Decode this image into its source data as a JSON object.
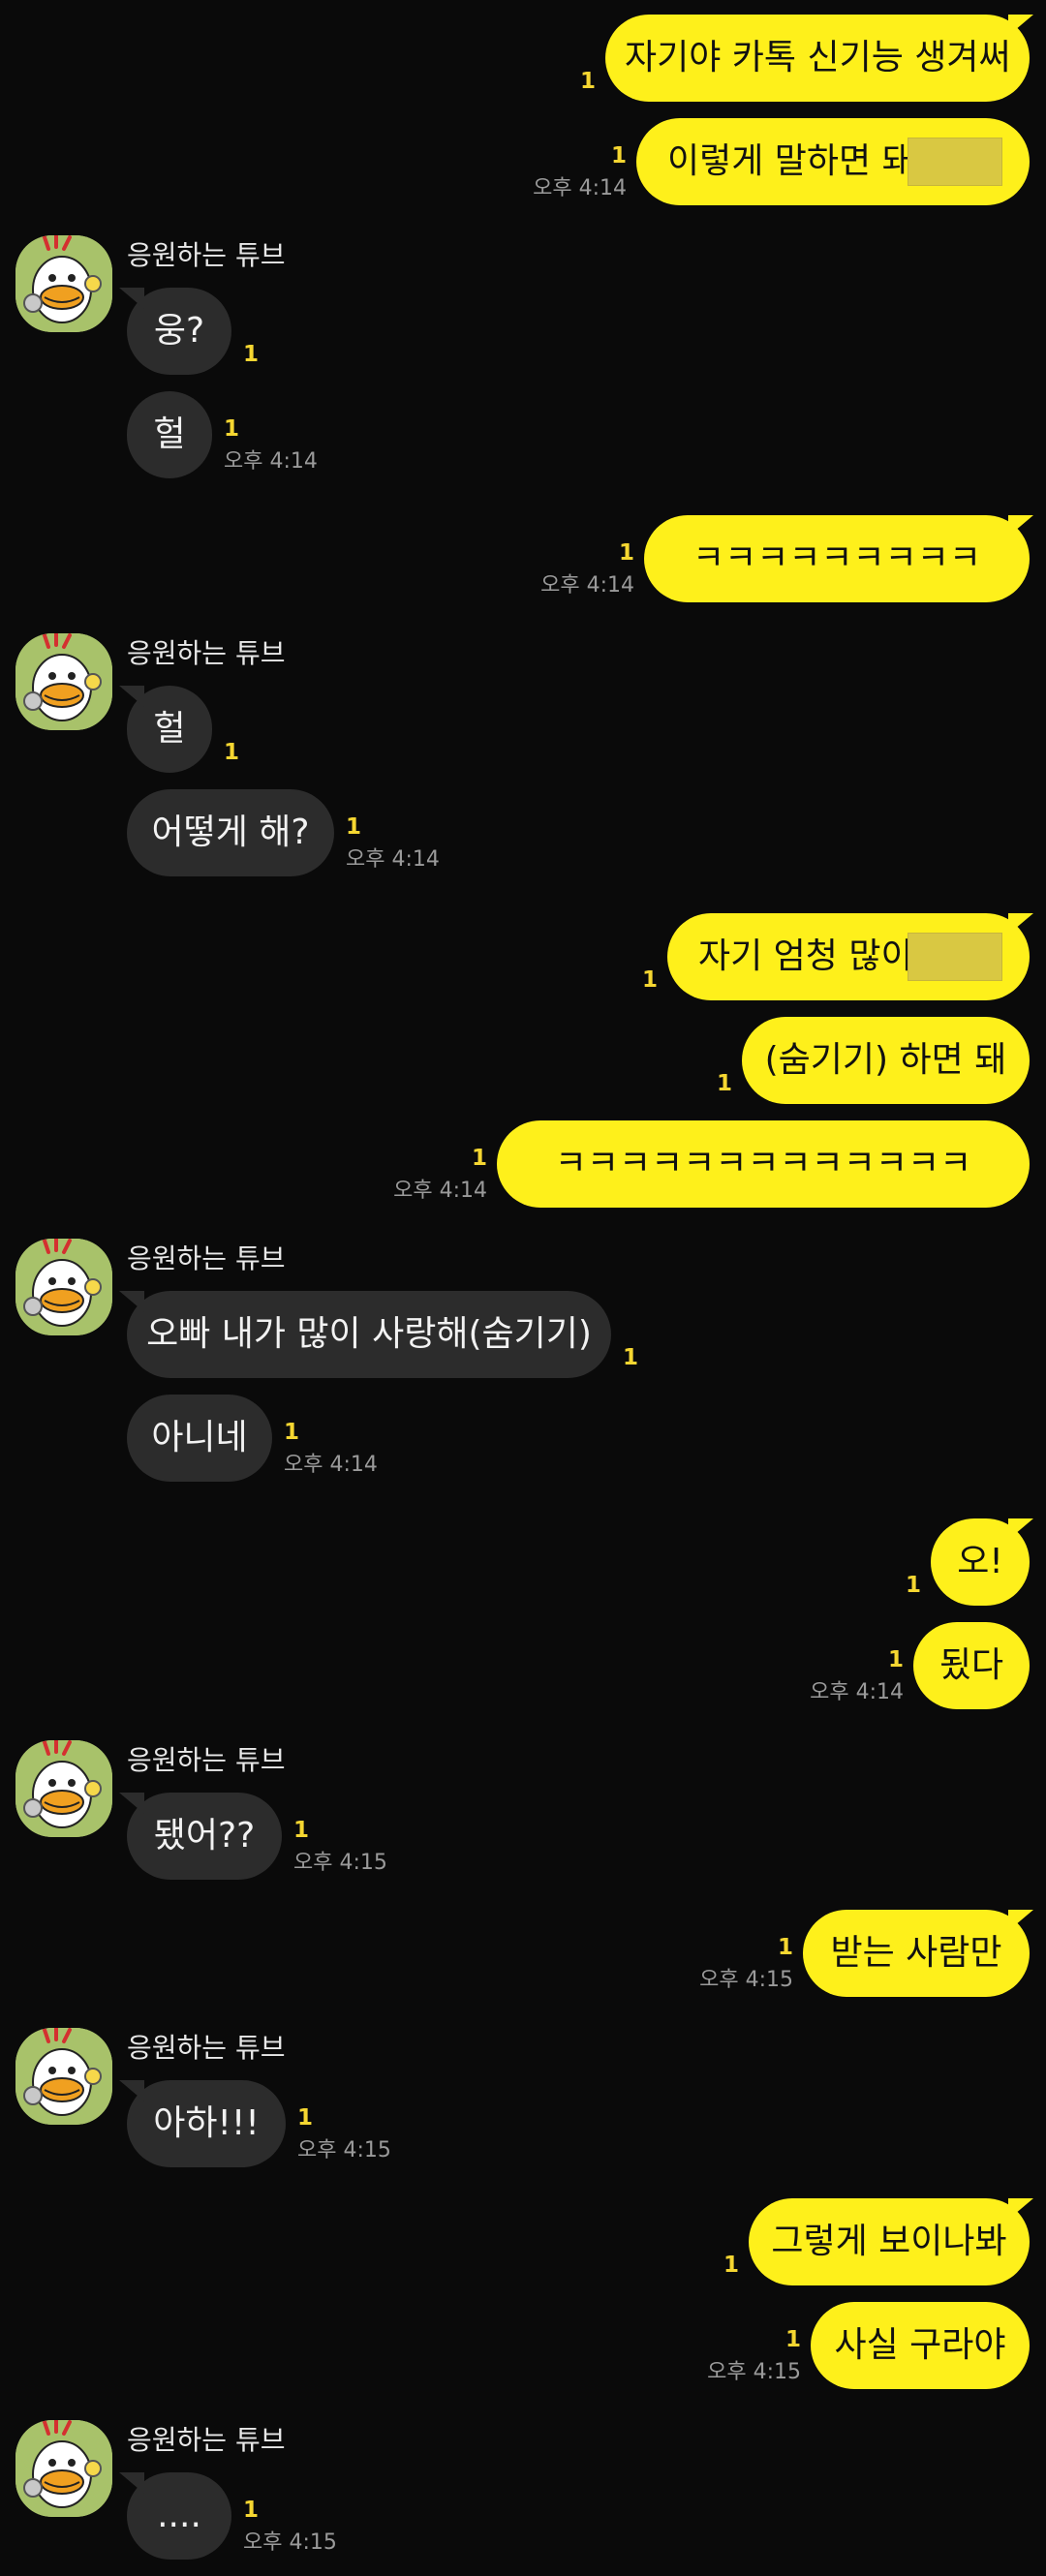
{
  "contact": {
    "name": "응원하는 튜브"
  },
  "colors": {
    "background": "#0a0a0a",
    "outgoing_bubble": "#fef01b",
    "incoming_bubble": "#2c2c2c",
    "read_count": "#f5d631"
  },
  "messages": [
    {
      "dir": "out",
      "text": "자기야 카톡 신기능 생겨써",
      "unread": "1",
      "time": ""
    },
    {
      "dir": "out",
      "text": "이렇게 말하면 돼",
      "unread": "1",
      "time": "오후 4:14",
      "redacted": true
    },
    {
      "dir": "in",
      "text": "웅?",
      "unread": "1",
      "time": "",
      "show_sender": true
    },
    {
      "dir": "in",
      "text": "헐",
      "unread": "1",
      "time": "오후 4:14"
    },
    {
      "dir": "out",
      "text": "ㅋㅋㅋㅋㅋㅋㅋㅋㅋ",
      "unread": "1",
      "time": "오후 4:14"
    },
    {
      "dir": "in",
      "text": "헐",
      "unread": "1",
      "time": "",
      "show_sender": true
    },
    {
      "dir": "in",
      "text": "어떻게 해?",
      "unread": "1",
      "time": "오후 4:14"
    },
    {
      "dir": "out",
      "text": "자기 엄청 많이",
      "unread": "1",
      "time": "",
      "redacted": true
    },
    {
      "dir": "out",
      "text": "(숨기기) 하면 돼",
      "unread": "1",
      "time": ""
    },
    {
      "dir": "out",
      "text": "ㅋㅋㅋㅋㅋㅋㅋㅋㅋㅋㅋㅋㅋ",
      "unread": "1",
      "time": "오후 4:14"
    },
    {
      "dir": "in",
      "text": "오빠 내가 많이 사랑해(숨기기)",
      "unread": "1",
      "time": "",
      "show_sender": true
    },
    {
      "dir": "in",
      "text": "아니네",
      "unread": "1",
      "time": "오후 4:14"
    },
    {
      "dir": "out",
      "text": "오!",
      "unread": "1",
      "time": ""
    },
    {
      "dir": "out",
      "text": "됬다",
      "unread": "1",
      "time": "오후 4:14"
    },
    {
      "dir": "in",
      "text": "됐어??",
      "unread": "1",
      "time": "오후 4:15",
      "show_sender": true
    },
    {
      "dir": "out",
      "text": "받는 사람만",
      "unread": "1",
      "time": "오후 4:15"
    },
    {
      "dir": "in",
      "text": "아하!!!",
      "unread": "1",
      "time": "오후 4:15",
      "show_sender": true
    },
    {
      "dir": "out",
      "text": "그렇게 보이나봐",
      "unread": "1",
      "time": ""
    },
    {
      "dir": "out",
      "text": "사실 구라야",
      "unread": "1",
      "time": "오후 4:15"
    },
    {
      "dir": "in",
      "text": "....",
      "unread": "1",
      "time": "오후 4:15",
      "show_sender": true
    }
  ]
}
